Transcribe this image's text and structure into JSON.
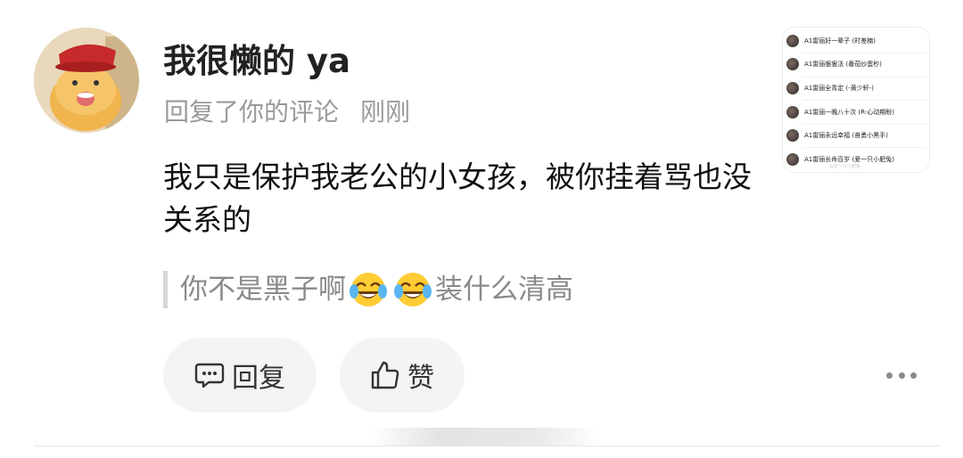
{
  "header": {
    "username": "我很懒的 ya",
    "action_text": "回复了你的评论",
    "timestamp": "刚刚"
  },
  "comment": {
    "text": "我只是保护我老公的小女孩，被你挂着骂也没关系的"
  },
  "quoted": {
    "prefix": "你不是黑子啊",
    "emojis": [
      "face-with-tears-of-joy-emoji",
      "face-with-tears-of-joy-emoji"
    ],
    "suffix": "装什么清高"
  },
  "actions": {
    "reply_label": "回复",
    "like_label": "赞"
  },
  "inset_list": {
    "items": [
      "A1雷丽好一辈子 (时差楠)",
      "A1雷丽狠狠法 (番茄炒蛋秒)",
      "A1雷丽全青定 (-黄少轩-)",
      "A1雷丽一晚八十次 (R-心动期盼)",
      "A1雷丽永远幸福 (奋勇小黑手)",
      "A1雷丽长命百岁 (爱一只小肥兔)"
    ],
    "footer": "@爱一只小肥兔"
  },
  "colors": {
    "primary_text": "#111111",
    "secondary_text": "#9a9a9a",
    "pill_bg": "#f4f4f5"
  }
}
